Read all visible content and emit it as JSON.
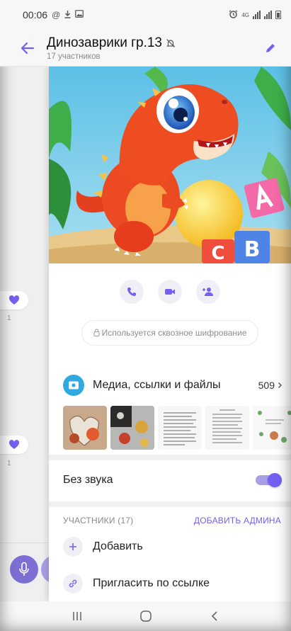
{
  "status_bar": {
    "time": "00:06",
    "network_badge": "4G"
  },
  "header": {
    "title": "Динозаврики гр.13",
    "subtitle": "17 участников"
  },
  "chat": {
    "reactions": [
      {
        "count": "1"
      },
      {
        "count": "1"
      }
    ]
  },
  "encryption": {
    "text": "Используется сквозное шифрование"
  },
  "media": {
    "label": "Медиа, ссылки и файлы",
    "count": "509"
  },
  "settings": {
    "mute_label": "Без звука",
    "mute_enabled": true
  },
  "members": {
    "title": "УЧАСТНИКИ (17)",
    "add_admin": "ДОБАВИТЬ АДМИНА",
    "add_label": "Добавить",
    "invite_label": "Пригласить по ссылке"
  },
  "colors": {
    "accent": "#7360f2",
    "accent_light": "#a79fe3",
    "media_icon": "#30a9e0"
  },
  "icons": {
    "back": "arrow-left-icon",
    "edit": "pencil-icon",
    "voice_call": "phone-icon",
    "video_call": "video-camera-icon",
    "group_call": "group-call-icon",
    "lock": "lock-icon",
    "media": "gallery-icon",
    "add": "plus-icon",
    "invite": "link-icon",
    "mute": "muted-bell-icon"
  }
}
